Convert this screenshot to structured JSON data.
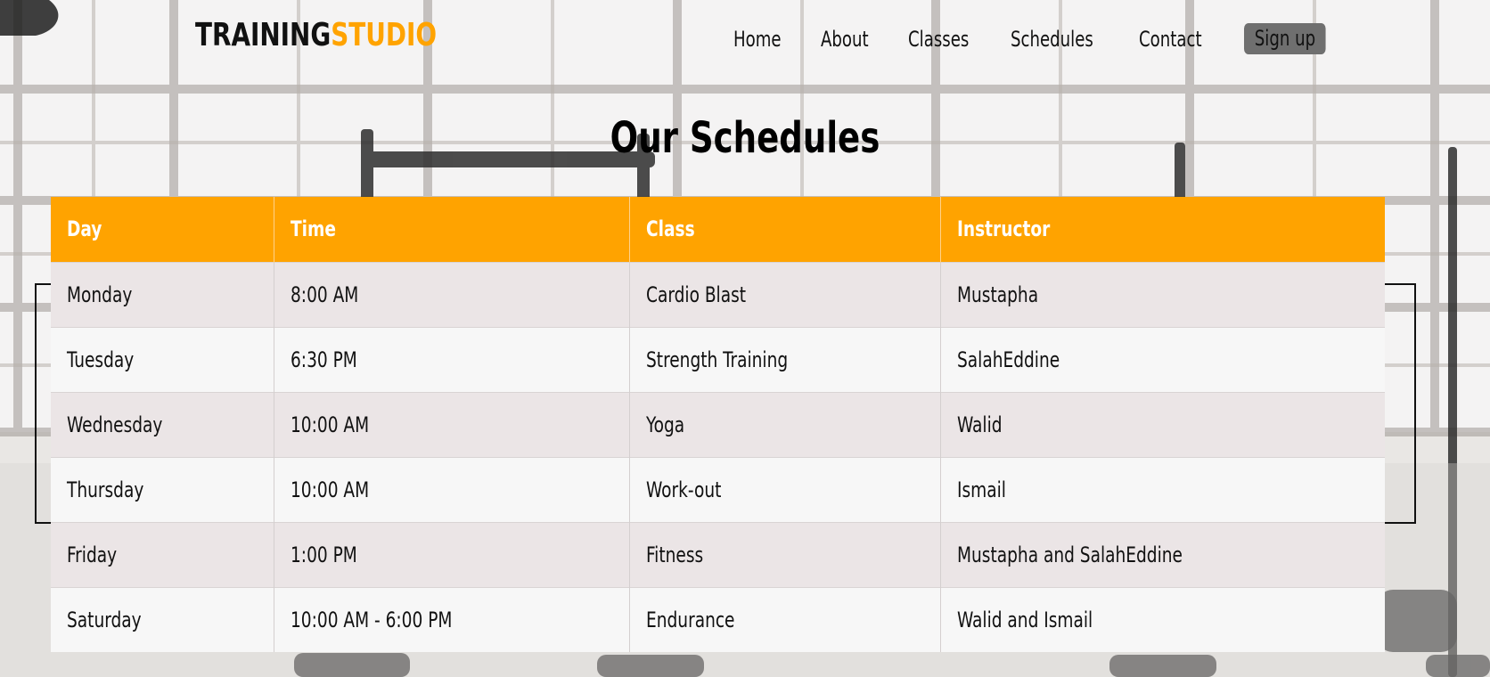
{
  "header": {
    "logo_part1": "TRAINING",
    "logo_part2": "STUDIO",
    "nav": {
      "home": "Home",
      "about": "About",
      "classes": "Classes",
      "schedules": "Schedules",
      "contact": "Contact",
      "signup": "Sign up"
    }
  },
  "main": {
    "title": "Our Schedules",
    "table": {
      "headers": [
        "Day",
        "Time",
        "Class",
        "Instructor"
      ],
      "rows": [
        [
          "Monday",
          "8:00 AM",
          "Cardio Blast",
          "Mustapha"
        ],
        [
          "Tuesday",
          "6:30 PM",
          "Strength Training",
          "SalahEddine"
        ],
        [
          "Wednesday",
          "10:00 AM",
          "Yoga",
          "Walid"
        ],
        [
          "Thursday",
          "10:00 AM",
          "Work-out",
          "Ismail"
        ],
        [
          "Friday",
          "1:00 PM",
          "Fitness",
          "Mustapha and SalahEddine"
        ],
        [
          "Saturday",
          "10:00 AM - 6:00 PM",
          "Endurance",
          "Walid and Ismail"
        ]
      ]
    }
  },
  "colors": {
    "accent": "#ffa300",
    "text": "#111111",
    "row_odd": "#ebe5e6",
    "row_even": "#f7f7f7",
    "signup_bg": "#6f6f6f"
  }
}
